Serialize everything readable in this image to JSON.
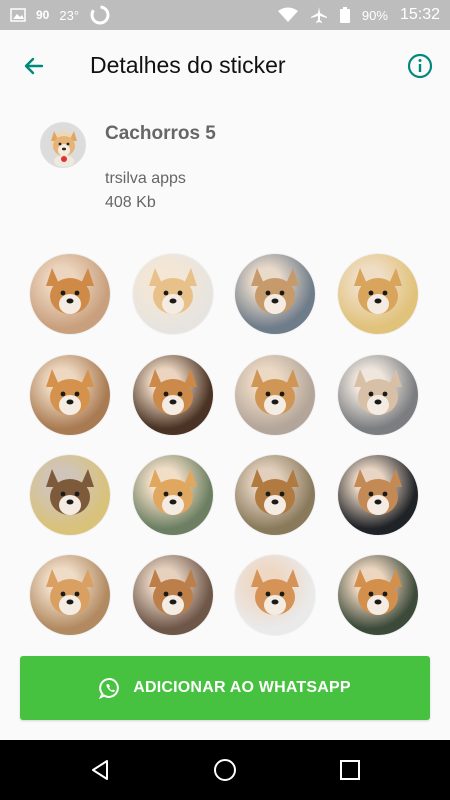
{
  "status_bar": {
    "left_num": "90",
    "temperature": "23°",
    "battery": "90%",
    "time": "15:32"
  },
  "app_bar": {
    "title": "Detalhes do sticker"
  },
  "pack": {
    "name": "Cachorros 5",
    "author": "trsilva apps",
    "size": "408 Kb"
  },
  "stickers": [
    {
      "bg": "#c9a07e",
      "fur": "#d08a47"
    },
    {
      "bg": "#e7e4df",
      "fur": "#e8c08a"
    },
    {
      "bg": "#6f7c8a",
      "fur": "#c69a6a"
    },
    {
      "bg": "#e1c27a",
      "fur": "#d9a45c"
    },
    {
      "bg": "#a97b52",
      "fur": "#d4924c"
    },
    {
      "bg": "#4a3324",
      "fur": "#cc8a4a"
    },
    {
      "bg": "#b3a59a",
      "fur": "#d09656"
    },
    {
      "bg": "#7b7d80",
      "fur": "#d8c0a6"
    },
    {
      "bg": "#d9c27a",
      "fur": "#7c5a3a"
    },
    {
      "bg": "#6c7f62",
      "fur": "#e0a760"
    },
    {
      "bg": "#8a7a5c",
      "fur": "#b07a40"
    },
    {
      "bg": "#1f2226",
      "fur": "#c48a56"
    },
    {
      "bg": "#b28a61",
      "fur": "#d9a062"
    },
    {
      "bg": "#6e5648",
      "fur": "#bd7f4a"
    },
    {
      "bg": "#eaeaea",
      "fur": "#d59358"
    },
    {
      "bg": "#3c4a3a",
      "fur": "#d38f4c"
    }
  ],
  "add_button": {
    "label": "ADICIONAR AO WHATSAPP"
  },
  "colors": {
    "accent": "#00897b",
    "button": "#46c240",
    "status_bar": "#bdbdbd"
  }
}
